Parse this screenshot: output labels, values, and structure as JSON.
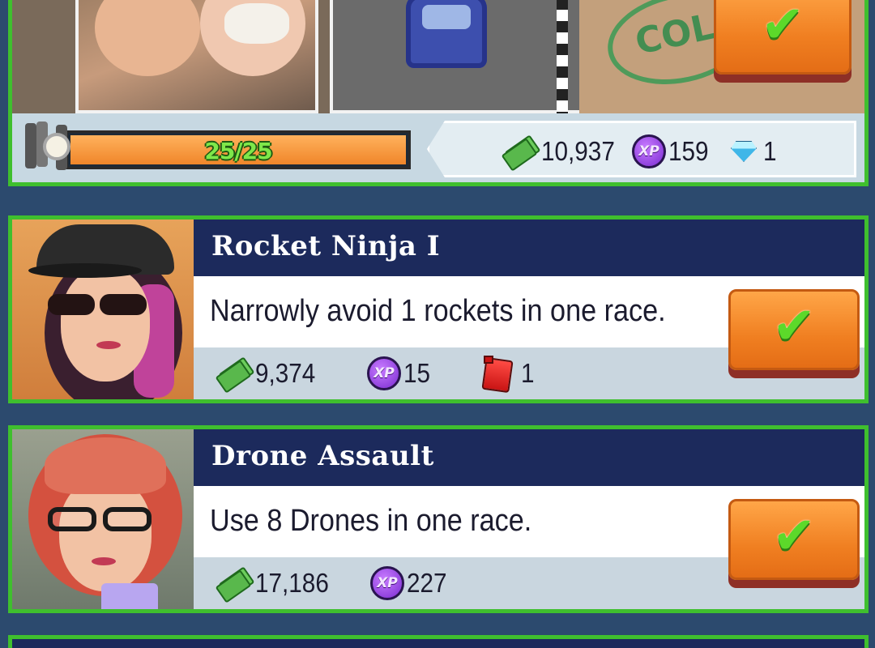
{
  "top_card": {
    "progress": {
      "text": "25/25",
      "fraction": 1.0
    },
    "rewards": [
      {
        "icon": "cash-icon",
        "value": "10,937"
      },
      {
        "icon": "xp-icon",
        "value": "159"
      },
      {
        "icon": "gem-icon",
        "value": "1"
      }
    ],
    "stamp_text": "COL",
    "xp_label": "XP"
  },
  "challenges": [
    {
      "title": "Rocket Ninja I",
      "description": "Narrowly avoid 1 rockets in one race.",
      "rewards": [
        {
          "icon": "cash-icon",
          "value": "9,374"
        },
        {
          "icon": "xp-icon",
          "value": "15"
        },
        {
          "icon": "fuel-icon",
          "value": "1"
        }
      ]
    },
    {
      "title": "Drone Assault",
      "description": "Use 8 Drones in one race.",
      "rewards": [
        {
          "icon": "cash-icon",
          "value": "17,186"
        },
        {
          "icon": "xp-icon",
          "value": "227"
        }
      ]
    }
  ],
  "colors": {
    "background": "#2c4a6e",
    "card_border": "#3fbf2e",
    "title_bar": "#1c2a5c",
    "claim_button": "#f07f21",
    "check": "#5cd92a"
  }
}
